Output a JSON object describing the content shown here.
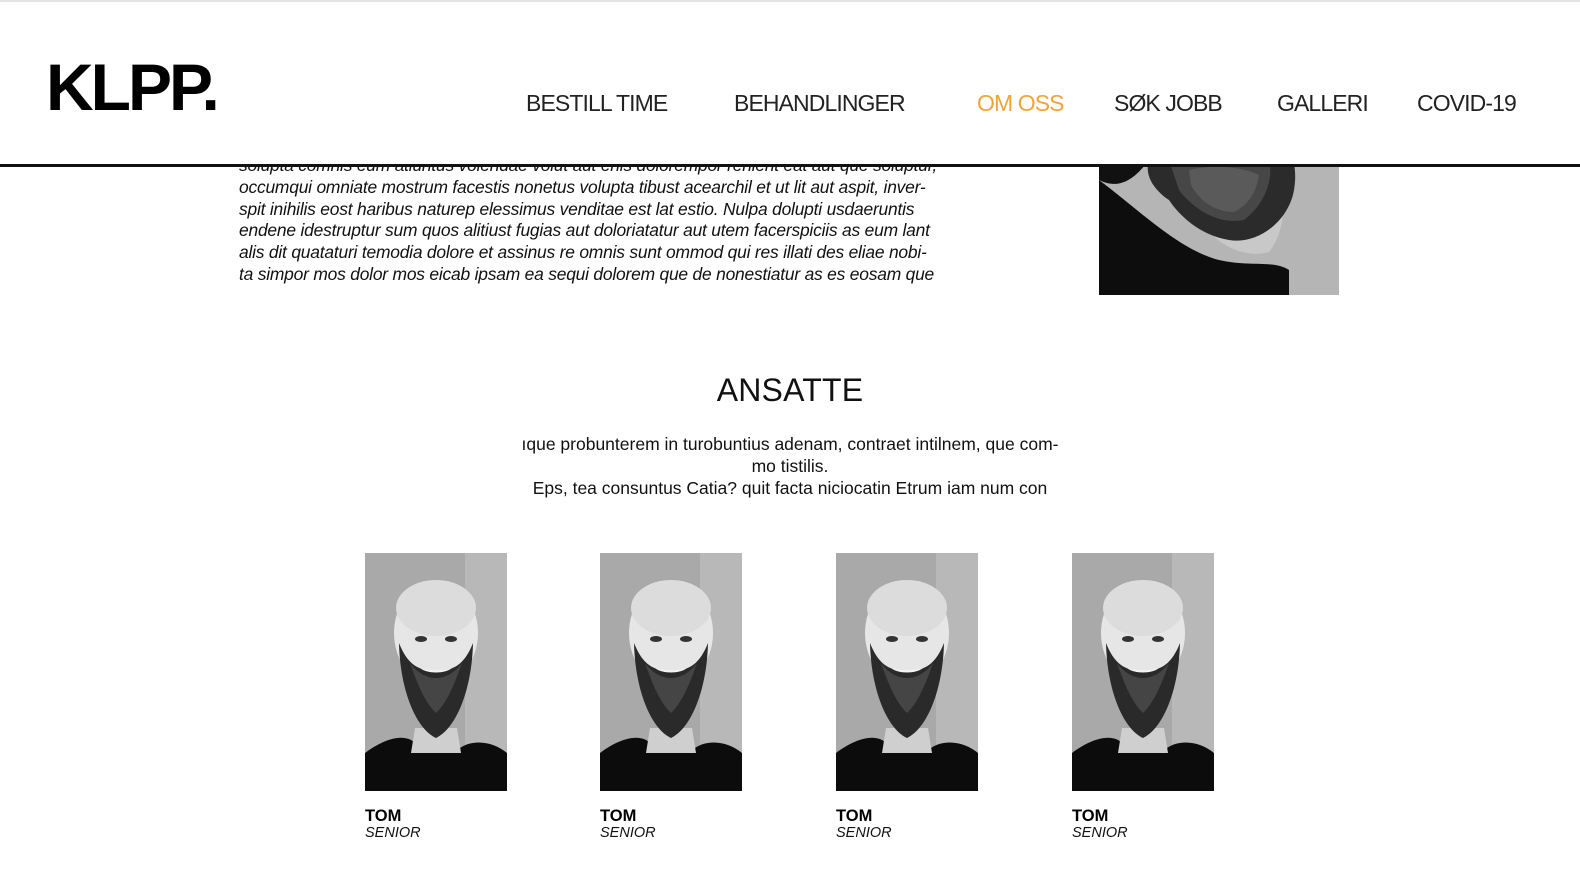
{
  "brand": {
    "logo": "KLPP."
  },
  "nav": {
    "items": [
      {
        "label": "BESTILL TIME",
        "active": false
      },
      {
        "label": "BEHANDLINGER",
        "active": false
      },
      {
        "label": "OM OSS",
        "active": true
      },
      {
        "label": "SØK JOBB",
        "active": false
      },
      {
        "label": "GALLERI",
        "active": false
      },
      {
        "label": "COVID-19",
        "active": false
      }
    ],
    "active_color": "#f0a43a"
  },
  "about": {
    "text": "solupta comnis eum atiuntus volendae volut aut enis dolorempor renient eat aut que soluptur,\noccumqui omniate mostrum facestis nonetus volupta tibust acearchil et ut lit aut aspit, inver-\nspit inihilis eost haribus naturep elessimus venditae est lat estio. Nulpa dolupti usdaeruntis\nendene idestruptur sum quos alitiust fugias aut doloriatatur aut utem facerspiciis as eum lant\nalis dit quataturi temodia dolore et assinus re omnis sunt ommod qui res illati des eliae nobi-\nta simpor mos dolor mos eicab ipsam ea sequi dolorem que de nonestiatur as es eosam que"
  },
  "staff_section": {
    "title": "ANSATTE",
    "intro": "ıque probunterem in turobuntius adenam, contraet intilnem, que com-\nmo tistilis.\nEps, tea consuntus Catia? quit facta niciocatin Etrum iam num con",
    "members": [
      {
        "name": "TOM",
        "role": "SENIOR"
      },
      {
        "name": "TOM",
        "role": "SENIOR"
      },
      {
        "name": "TOM",
        "role": "SENIOR"
      },
      {
        "name": "TOM",
        "role": "SENIOR"
      }
    ]
  }
}
